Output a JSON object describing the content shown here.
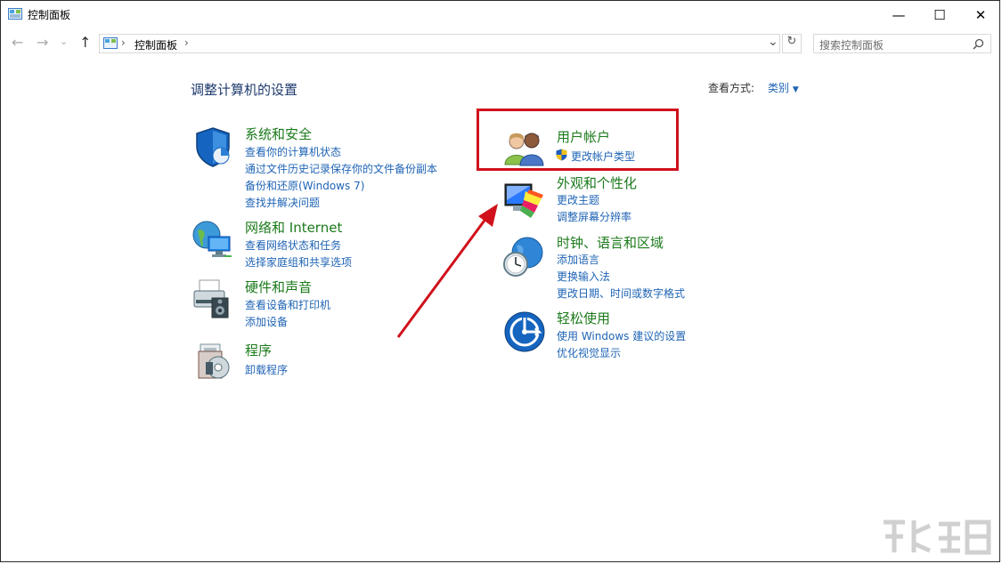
{
  "window": {
    "title": "控制面板",
    "minimize": "—",
    "maximize": "☐",
    "close": "✕"
  },
  "nav": {
    "back": "←",
    "forward": "→",
    "recent": "⌄",
    "up": "↑"
  },
  "address": {
    "path": "控制面板",
    "sep": "›",
    "end_sep": "›",
    "dropdown": "⌄",
    "refresh": "↻"
  },
  "search": {
    "placeholder": "搜索控制面板",
    "icon": "search-icon"
  },
  "header": {
    "title": "调整计算机的设置",
    "view_label": "查看方式:",
    "view_value": "类别"
  },
  "categories": [
    {
      "title": "系统和安全",
      "links": [
        "查看你的计算机状态",
        "通过文件历史记录保存你的文件备份副本",
        "备份和还原(Windows 7)",
        "查找并解决问题"
      ]
    },
    {
      "title": "网络和 Internet",
      "links": [
        "查看网络状态和任务",
        "选择家庭组和共享选项"
      ]
    },
    {
      "title": "硬件和声音",
      "links": [
        "查看设备和打印机",
        "添加设备"
      ]
    },
    {
      "title": "程序",
      "links": [
        "卸载程序"
      ]
    },
    {
      "title": "用户帐户",
      "links": [
        "更改帐户类型"
      ]
    },
    {
      "title": "外观和个性化",
      "links": [
        "更改主题",
        "调整屏幕分辨率"
      ]
    },
    {
      "title": "时钟、语言和区域",
      "links": [
        "添加语言",
        "更换输入法",
        "更改日期、时间或数字格式"
      ]
    },
    {
      "title": "轻松使用",
      "links": [
        "使用 Windows 建议的设置",
        "优化视觉显示"
      ]
    }
  ],
  "colors": {
    "link": "#1f64b5",
    "category": "#1b7a1b",
    "highlight": "#d0111b"
  }
}
